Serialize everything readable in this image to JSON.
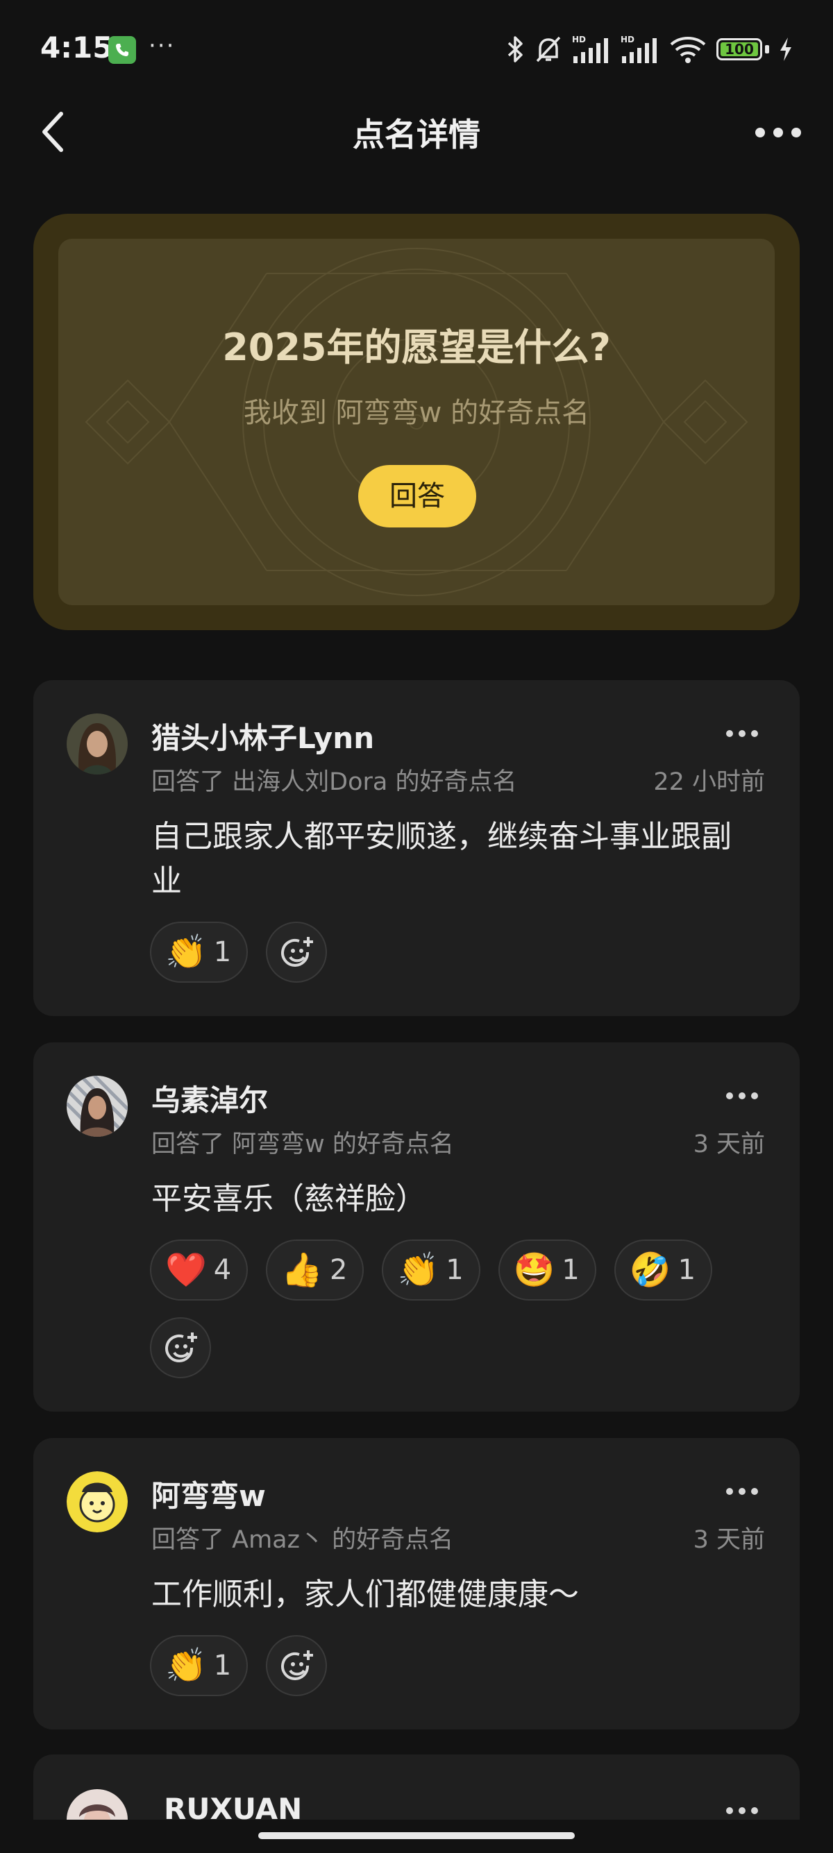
{
  "status_bar": {
    "time": "4:15",
    "more": "···",
    "battery": "100",
    "icons": [
      "phone-call-icon",
      "bluetooth-icon",
      "mute-bell-icon",
      "hd-signal-icon",
      "hd-signal-icon",
      "wifi-icon",
      "battery-icon",
      "charging-icon"
    ]
  },
  "nav": {
    "title": "点名详情",
    "back_icon": "chevron-left-icon",
    "more_icon": "more-horizontal-icon"
  },
  "hero": {
    "title": "2025年的愿望是什么?",
    "subtitle": "我收到 阿弯弯w 的好奇点名",
    "button": "回答",
    "bg_color": "#3a3114",
    "button_color": "#f6cd43"
  },
  "posts": [
    {
      "username": "猎头小林子Lynn",
      "meta": "回答了 出海人刘Dora 的好奇点名",
      "time": "22 小时前",
      "content": "自己跟家人都平安顺遂，继续奋斗事业跟副业",
      "reactions": [
        {
          "emoji": "👏",
          "count": "1"
        }
      ]
    },
    {
      "username": "乌素淖尔",
      "meta": "回答了 阿弯弯w 的好奇点名",
      "time": "3 天前",
      "content": "平安喜乐（慈祥脸）",
      "reactions": [
        {
          "emoji": "❤️",
          "count": "4"
        },
        {
          "emoji": "👍",
          "count": "2"
        },
        {
          "emoji": "👏",
          "count": "1"
        },
        {
          "emoji": "🤩",
          "count": "1"
        },
        {
          "emoji": "🤣",
          "count": "1"
        }
      ]
    },
    {
      "username": "阿弯弯w",
      "meta": "回答了 Amaz丶 的好奇点名",
      "time": "3 天前",
      "content": "工作顺利，家人们都健健康康～",
      "reactions": [
        {
          "emoji": "👏",
          "count": "1"
        }
      ]
    },
    {
      "username": "RUXUAN"
    }
  ]
}
